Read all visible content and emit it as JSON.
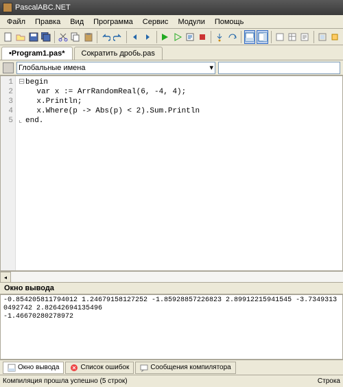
{
  "window": {
    "title": "PascalABC.NET"
  },
  "menu": [
    "Файл",
    "Правка",
    "Вид",
    "Программа",
    "Сервис",
    "Модули",
    "Помощь"
  ],
  "tabs": [
    {
      "label": "•Program1.pas*",
      "active": true
    },
    {
      "label": "Сократить дробь.pas",
      "active": false
    }
  ],
  "scope": {
    "label": "Глобальные имена"
  },
  "code": {
    "lines": [
      "1",
      "2",
      "3",
      "4",
      "5"
    ],
    "l1": "begin",
    "l2": "  var x := ArrRandomReal(6, -4, 4);",
    "l3": "  x.Println;",
    "l4": "  x.Where(p -> Abs(p) < 2).Sum.Println",
    "l5": "end."
  },
  "output": {
    "title": "Окно вывода",
    "text": "-0.854205811794012 1.24679158127252 -1.85928857226823 2.89912215941545 -3.73493130492742 2.82642694135496\n-1.46670280278972"
  },
  "output_tabs": [
    "Окно вывода",
    "Список ошибок",
    "Сообщения компилятора"
  ],
  "status": {
    "left": "Компиляция прошла успешно (5 строк)",
    "right": "Строка"
  }
}
